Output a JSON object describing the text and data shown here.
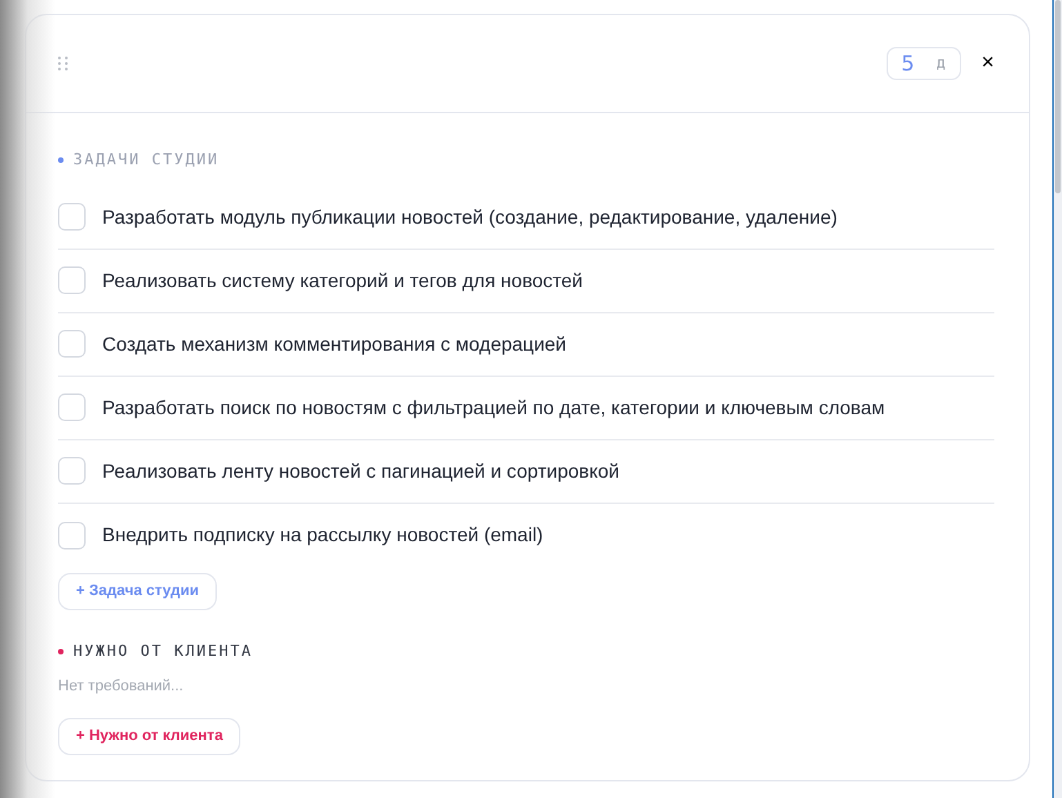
{
  "header": {
    "days": {
      "value": "5",
      "unit": "д"
    },
    "close": "×"
  },
  "sections": [
    {
      "title": "ЗАДАЧИ СТУДИИ",
      "color": "#6b8cf0",
      "tasks": [
        {
          "text": "Разработать модуль публикации новостей (создание, редактирование, удаление)",
          "checked": false
        },
        {
          "text": "Реализовать систему категорий и тегов для новостей",
          "checked": false
        },
        {
          "text": "Создать механизм комментирования с модерацией",
          "checked": false
        },
        {
          "text": "Разработать поиск по новостям с фильтрацией по дате, категории и ключевым словам",
          "checked": false
        },
        {
          "text": "Реализовать ленту новостей с пагинацией и сортировкой",
          "checked": false
        },
        {
          "text": "Внедрить подписку на рассылку новостей (email)",
          "checked": false
        }
      ],
      "add_button": "+ Задача студии"
    },
    {
      "title": "НУЖНО ОТ КЛИЕНТА",
      "color": "#e0245e",
      "empty_text": "Нет требований...",
      "add_button": "+ Нужно от клиента"
    }
  ]
}
